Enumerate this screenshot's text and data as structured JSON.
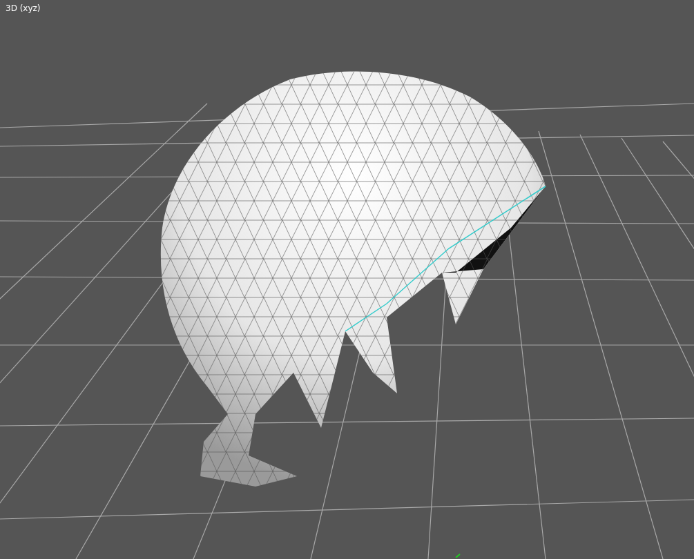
{
  "viewport": {
    "label": "3D (xyz)"
  }
}
